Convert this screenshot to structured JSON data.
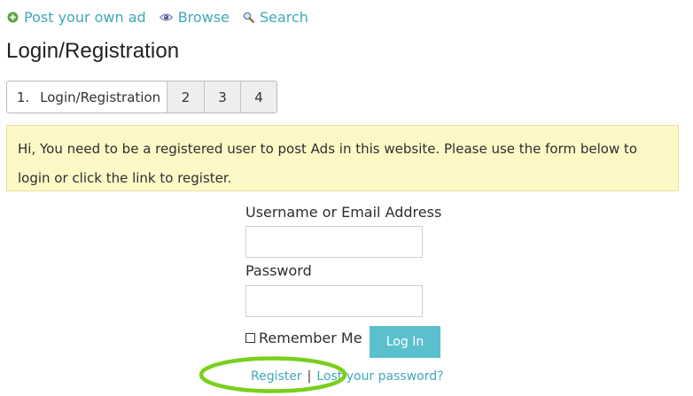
{
  "topnav": {
    "items": [
      {
        "label": "Post your own ad",
        "icon": "plus-circle-icon"
      },
      {
        "label": "Browse",
        "icon": "eye-icon"
      },
      {
        "label": "Search",
        "icon": "magnifier-icon"
      }
    ]
  },
  "page": {
    "title": "Login/Registration"
  },
  "steps": {
    "active_number": "1.",
    "active_label": "Login/Registration",
    "others": [
      "2",
      "3",
      "4"
    ]
  },
  "notice": {
    "text": "Hi, You need to be a registered user to post Ads in this website. Please use the form below to login or click the link to register."
  },
  "form": {
    "username_label": "Username or Email Address",
    "username_value": "",
    "password_label": "Password",
    "password_value": "",
    "remember_label": "Remember Me",
    "remember_checked": false,
    "login_button": "Log In"
  },
  "links": {
    "register": "Register",
    "separator": "|",
    "lost_password": "Lost your password?"
  },
  "colors": {
    "link": "#3fa9b5",
    "button": "#5bc0cd",
    "notice_bg": "#fdf9c7",
    "annotation": "#79d01d"
  }
}
